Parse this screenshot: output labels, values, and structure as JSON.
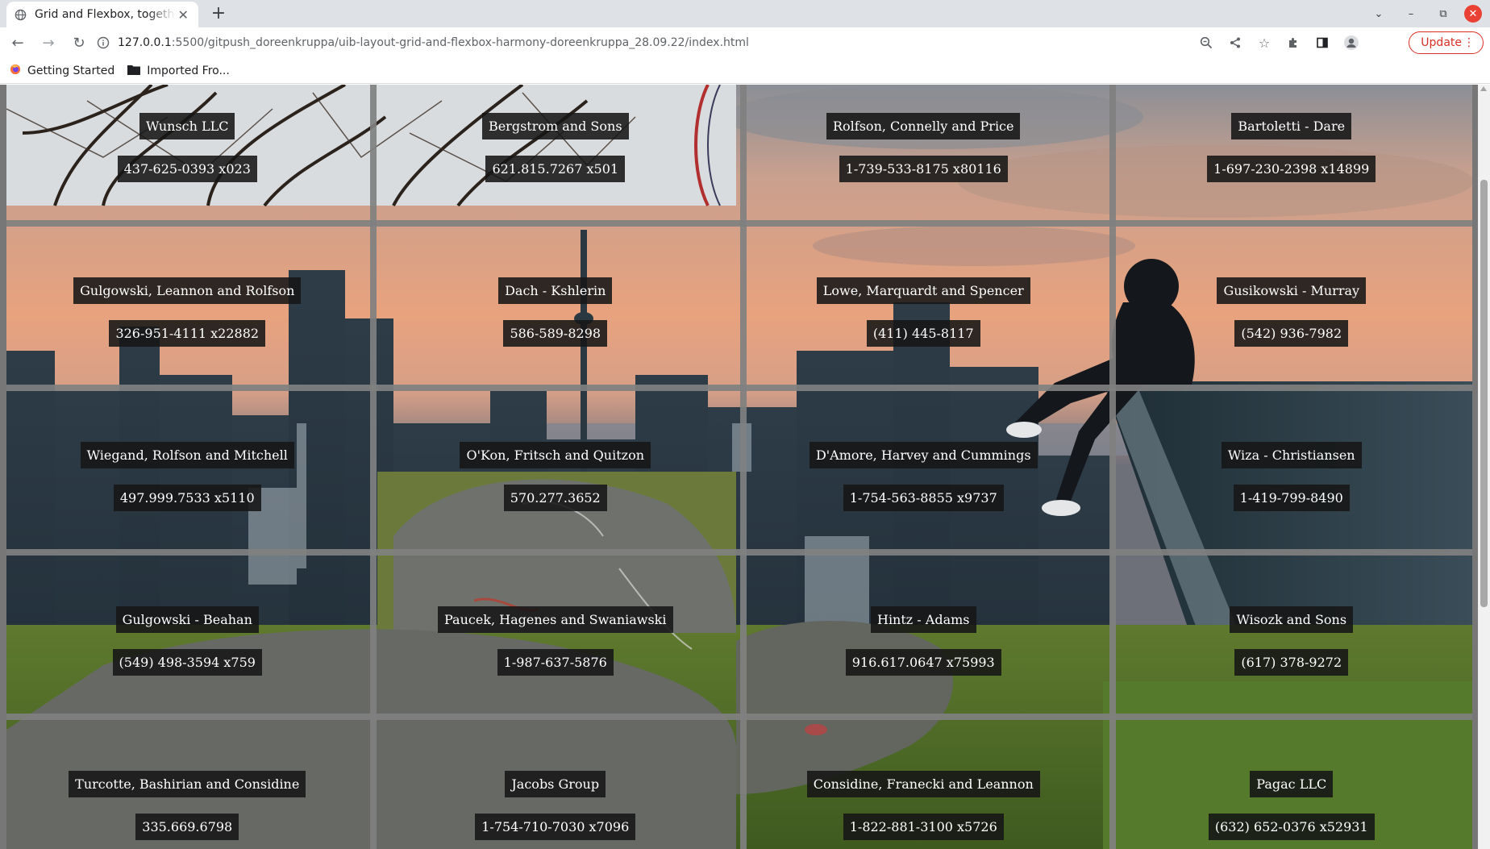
{
  "browser": {
    "tab_title": "Grid and Flexbox, together",
    "url_host": "127.0.0.1",
    "url_path": ":5500/gitpush_doreenkruppa/uib-layout-grid-and-flexbox-harmony-doreenkruppa_28.09.22/index.html",
    "update_label": "Update",
    "bookmarks": [
      "Getting Started",
      "Imported Fro..."
    ]
  },
  "cards": [
    {
      "name": "Wunsch LLC",
      "phone": "437-625-0393 x023"
    },
    {
      "name": "Bergstrom and Sons",
      "phone": "621.815.7267 x501"
    },
    {
      "name": "Rolfson, Connelly and Price",
      "phone": "1-739-533-8175 x80116"
    },
    {
      "name": "Bartoletti - Dare",
      "phone": "1-697-230-2398 x14899"
    },
    {
      "name": "Gulgowski, Leannon and Rolfson",
      "phone": "326-951-4111 x22882"
    },
    {
      "name": "Dach - Kshlerin",
      "phone": "586-589-8298"
    },
    {
      "name": "Lowe, Marquardt and Spencer",
      "phone": "(411) 445-8117"
    },
    {
      "name": "Gusikowski - Murray",
      "phone": "(542) 936-7982"
    },
    {
      "name": "Wiegand, Rolfson and Mitchell",
      "phone": "497.999.7533 x5110"
    },
    {
      "name": "O'Kon, Fritsch and Quitzon",
      "phone": "570.277.3652"
    },
    {
      "name": "D'Amore, Harvey and Cummings",
      "phone": "1-754-563-8855 x9737"
    },
    {
      "name": "Wiza - Christiansen",
      "phone": "1-419-799-8490"
    },
    {
      "name": "Gulgowski - Beahan",
      "phone": "(549) 498-3594 x759"
    },
    {
      "name": "Paucek, Hagenes and Swaniawski",
      "phone": "1-987-637-5876"
    },
    {
      "name": "Hintz - Adams",
      "phone": "916.617.0647 x75993"
    },
    {
      "name": "Wisozk and Sons",
      "phone": "(617) 378-9272"
    },
    {
      "name": "Turcotte, Bashirian and Considine",
      "phone": "335.669.6798"
    },
    {
      "name": "Jacobs Group",
      "phone": "1-754-710-7030 x7096"
    },
    {
      "name": "Considine, Franecki and Leannon",
      "phone": "1-822-881-3100 x5726"
    },
    {
      "name": "Pagac LLC",
      "phone": "(632) 652-0376 x52931"
    }
  ]
}
